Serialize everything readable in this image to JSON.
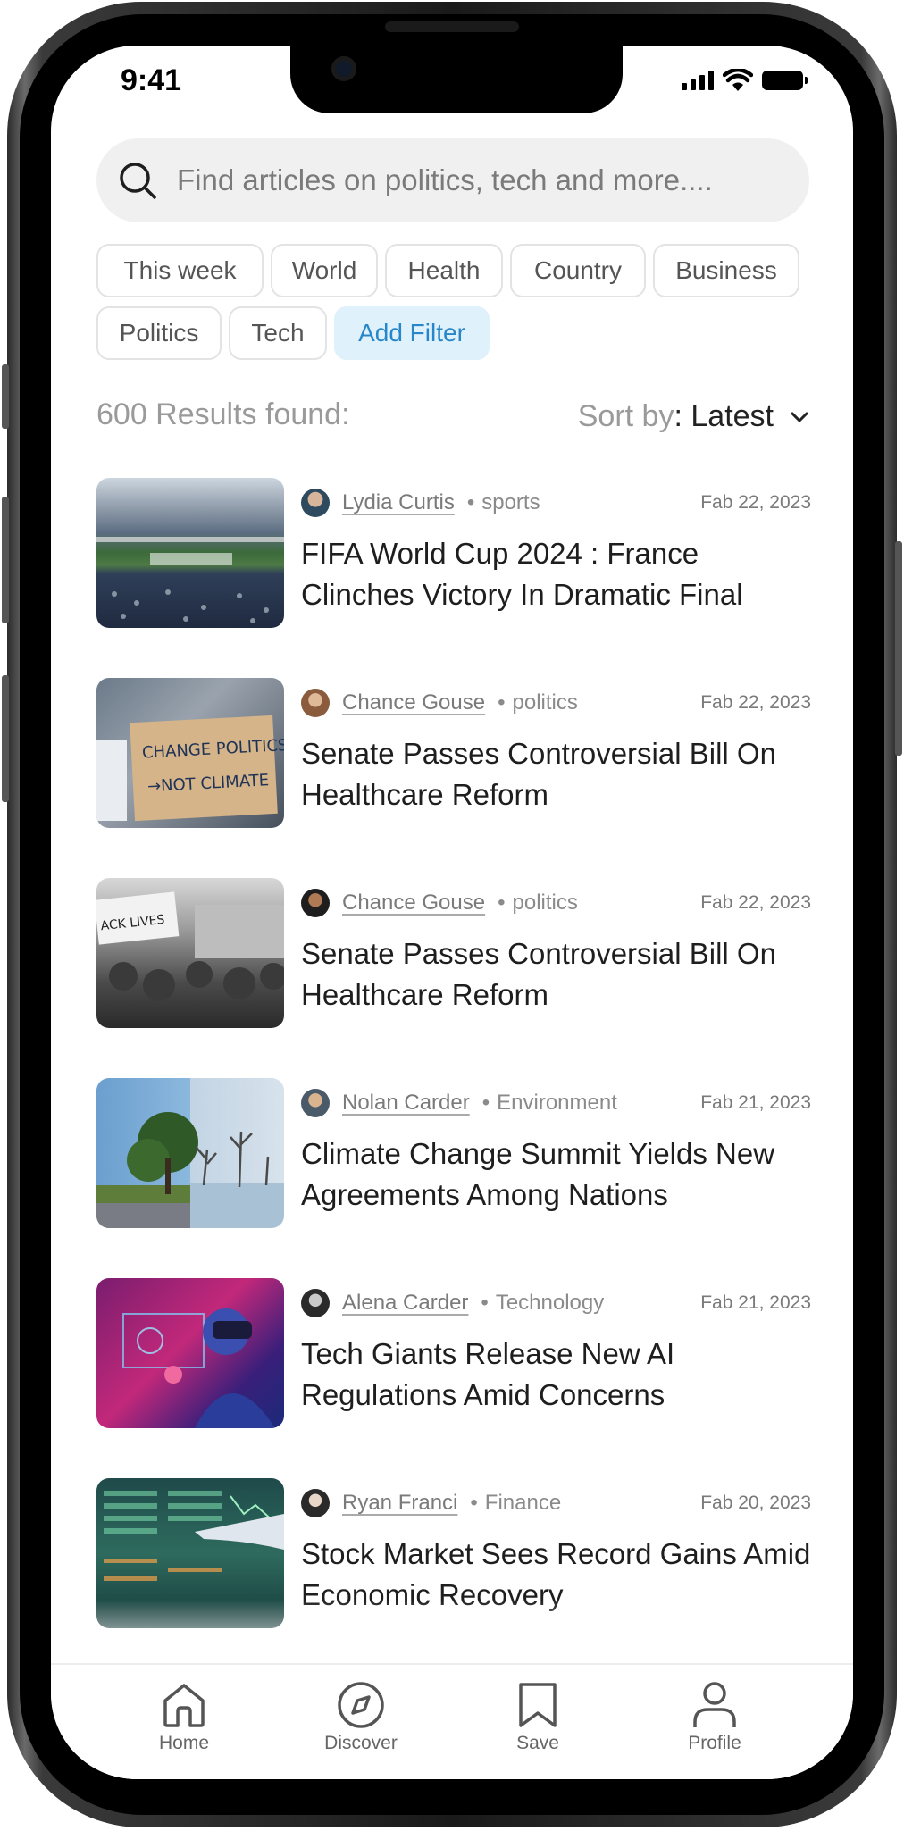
{
  "status_bar": {
    "time": "9:41"
  },
  "search": {
    "placeholder": "Find articles on politics, tech and more...."
  },
  "filters": [
    {
      "label": "This week"
    },
    {
      "label": "World"
    },
    {
      "label": "Health"
    },
    {
      "label": "Country"
    },
    {
      "label": "Business"
    },
    {
      "label": "Politics"
    },
    {
      "label": "Tech"
    },
    {
      "label": "Add Filter"
    }
  ],
  "results": {
    "count_text": "600 Results found:",
    "sort_label": "Sort by",
    "sort_value": "Latest"
  },
  "articles": [
    {
      "author": "Lydia Curtis",
      "category": "sports",
      "date": "Fab 22, 2023",
      "title": "FIFA World Cup 2024 : France Clinches Victory In Dramatic Final"
    },
    {
      "author": "Chance Gouse",
      "category": "politics",
      "date": "Fab 22, 2023",
      "title": "Senate Passes Controversial Bill On Healthcare Reform"
    },
    {
      "author": "Chance Gouse",
      "category": "politics",
      "date": "Fab 22, 2023",
      "title": "Senate Passes Controversial Bill On Healthcare Reform"
    },
    {
      "author": "Nolan Carder",
      "category": "Environment",
      "date": "Fab 21, 2023",
      "title": "Climate Change Summit Yields New Agreements Among Nations"
    },
    {
      "author": "Alena Carder",
      "category": "Technology",
      "date": "Fab 21, 2023",
      "title": "Tech Giants Release New AI Regulations Amid Concerns"
    },
    {
      "author": "Ryan Franci",
      "category": "Finance",
      "date": "Fab 20, 2023",
      "title": "Stock Market Sees Record Gains Amid Economic Recovery"
    }
  ],
  "tabbar": [
    {
      "label": "Home",
      "icon": "home-icon"
    },
    {
      "label": "Discover",
      "icon": "compass-icon"
    },
    {
      "label": "Save",
      "icon": "bookmark-icon"
    },
    {
      "label": "Profile",
      "icon": "profile-icon"
    }
  ],
  "colors": {
    "accent": "#2887c8",
    "accent_bg": "#dff1fb",
    "chip_border": "#e3e3e3"
  }
}
